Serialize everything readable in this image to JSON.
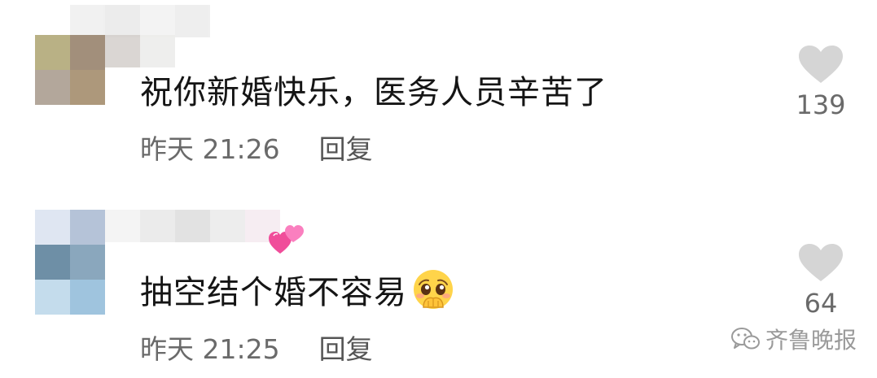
{
  "comments": [
    {
      "text": "祝你新婚快乐，医务人员辛苦了",
      "time": "昨天 21:26",
      "reply_label": "回复",
      "like_count": "139",
      "avatar_colors": [
        "#e3e3e1",
        "#eaeae8",
        "#b9b185",
        "#a28f7b",
        "#b3a79b",
        "#ad987b"
      ],
      "name_colors": [
        "#cfc7c4",
        "#ececea",
        "#f1f1f1"
      ]
    },
    {
      "text": "抽空结个婚不容易",
      "time": "昨天 21:25",
      "reply_label": "回复",
      "like_count": "64",
      "avatar_colors": [
        "#dfe6f2",
        "#b5c3d8",
        "#6e8fa6",
        "#8aa7bd",
        "#c4dcec",
        "#9fc4de"
      ],
      "name_colors": [
        "#f1f1f1",
        "#e6e6e6",
        "#dadada",
        "#e8e8e8",
        "#f4e8ee"
      ]
    }
  ],
  "watermark": {
    "text": "齐鲁晚报",
    "icon": "wechat-icon"
  },
  "icons": {
    "like": "heart-icon",
    "sticker": "pink-hearts-icon",
    "emoji": "pleading-face-icon"
  },
  "colors": {
    "heart": "#d5d5d5",
    "text": "#151515",
    "meta": "#6a6a6a"
  }
}
